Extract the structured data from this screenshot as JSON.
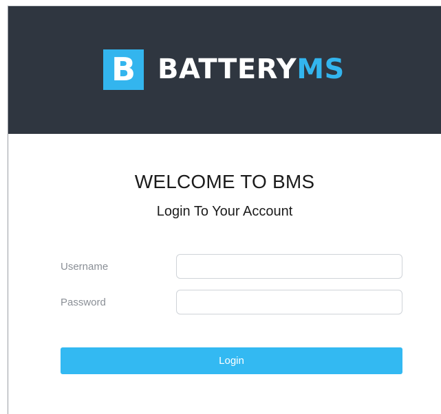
{
  "header": {
    "logo_badge_letter": "B",
    "logo_text_primary": "BATTERY",
    "logo_text_accent": "MS"
  },
  "main": {
    "title": "WELCOME TO BMS",
    "subtitle": "Login To Your Account"
  },
  "form": {
    "username_label": "Username",
    "username_value": "",
    "password_label": "Password",
    "password_value": "",
    "login_label": "Login"
  },
  "colors": {
    "header_background": "#2f3640",
    "accent": "#33b5ee",
    "button": "#33b9f2"
  }
}
